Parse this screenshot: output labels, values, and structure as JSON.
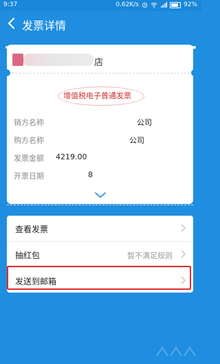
{
  "status": {
    "time": "9:37",
    "speed": "0.62K/s",
    "battery": "92%"
  },
  "header": {
    "title": "发票详情"
  },
  "invoice": {
    "shop_suffix": "店",
    "type": "增值税电子普通发票",
    "rows": [
      {
        "label": "销方名称",
        "value": "公司"
      },
      {
        "label": "购方名称",
        "value": "公司"
      },
      {
        "label": "发票金额",
        "value": "4219.00"
      },
      {
        "label": "开票日期",
        "value": "8"
      }
    ]
  },
  "menu": {
    "items": [
      {
        "label": "查看发票",
        "extra": ""
      },
      {
        "label": "抽红包",
        "extra": "暂不满足规则"
      },
      {
        "label": "发送到邮箱",
        "extra": ""
      }
    ]
  },
  "colors": {
    "header_bg": "#1f8ee0",
    "stamp_red": "#d32f2f",
    "highlight_red": "#e02b2b"
  }
}
